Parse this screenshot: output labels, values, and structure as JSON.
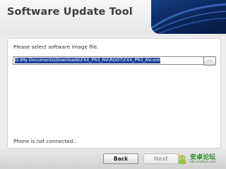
{
  "header": {
    "title": "Software Update Tool"
  },
  "main": {
    "prompt": "Please select software image file.",
    "file_path": "D:\\My Documents\\Downloads\\FXX_PR3_NV\\ROOT\\FXX_PR3_NV.xml",
    "browse_label": "...",
    "status_text": "Phone is not connected..."
  },
  "footer": {
    "back_label": "Back",
    "next_label": "Next",
    "next_enabled": false
  },
  "watermark": {
    "text": "安卓论坛",
    "url": "bbs.anzhuo.com"
  },
  "colors": {
    "header_accent": "#0b2559",
    "selection": "#1c3f9a",
    "watermark_green": "#2f8f2a"
  }
}
